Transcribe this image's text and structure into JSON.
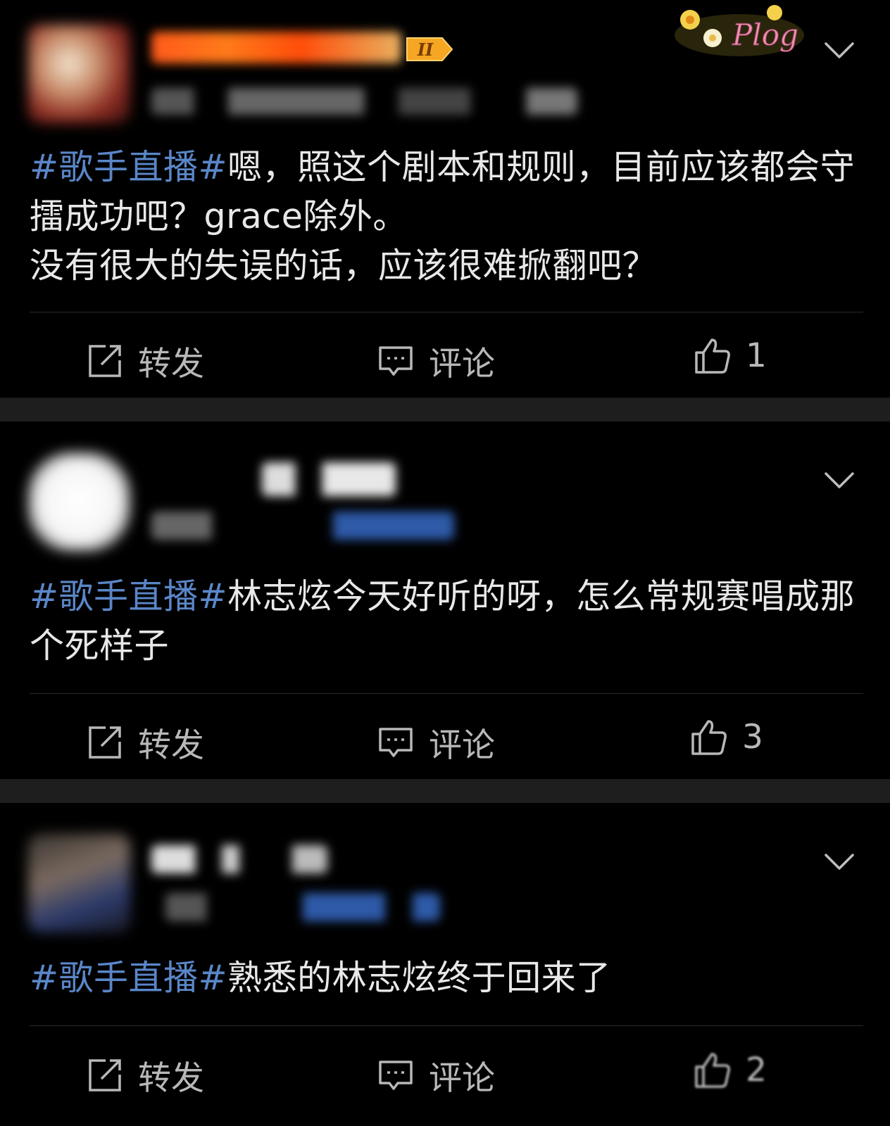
{
  "posts": [
    {
      "hashtag": "#歌手直播#",
      "text": "嗯，照这个剧本和规则，目前应该都会守擂成功吧？grace除外。\n没有很大的失误的话，应该很难掀翻吧？",
      "actions": {
        "repost": "转发",
        "comment": "评论",
        "likes": "1"
      }
    },
    {
      "hashtag": "#歌手直播#",
      "text": "林志炫今天好听的呀，怎么常规赛唱成那个死样子",
      "actions": {
        "repost": "转发",
        "comment": "评论",
        "likes": "3"
      }
    },
    {
      "hashtag": "#歌手直播#",
      "text": "熟悉的林志炫终于回来了",
      "actions": {
        "repost": "转发",
        "comment": "评论",
        "likes": "2"
      }
    }
  ],
  "badge": {
    "label": "II"
  },
  "sticker": {
    "label": "Plog"
  },
  "icons": [
    "repost-icon",
    "comment-icon",
    "like-icon",
    "chevron-down-icon"
  ],
  "colors": {
    "background": "#000000",
    "hashtag": "#5a86c8",
    "text": "#e8e8e8",
    "muted": "#b8b8b8"
  }
}
